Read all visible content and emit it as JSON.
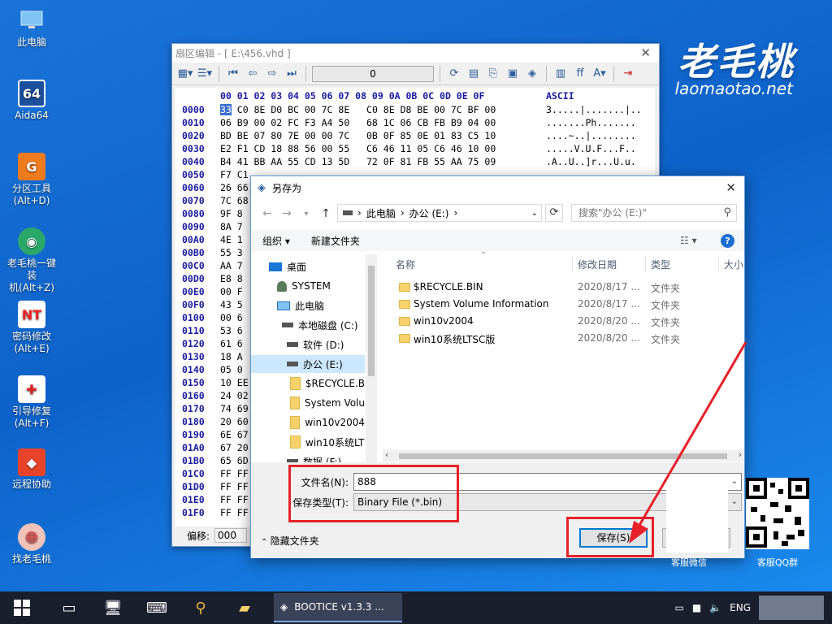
{
  "desktop": {
    "icons": [
      {
        "label": "此电脑",
        "icon": "computer-icon"
      },
      {
        "label": "Aida64",
        "icon": "aida64-icon"
      },
      {
        "label": "分区工具\n(Alt+D)",
        "icon": "partition-tool-icon"
      },
      {
        "label": "老毛桃一键装\n机(Alt+Z)",
        "icon": "installer-icon"
      },
      {
        "label": "密码修改\n(Alt+E)",
        "icon": "password-icon"
      },
      {
        "label": "引导修复\n(Alt+F)",
        "icon": "boot-repair-icon"
      },
      {
        "label": "远程协助",
        "icon": "remote-assist-icon"
      },
      {
        "label": "找老毛桃",
        "icon": "find-laomaotao-icon"
      }
    ],
    "watermark_logo": "老毛桃",
    "watermark_url": "laomaotao.net",
    "qr_left_caption": "客服微信",
    "qr_right_caption": "客服QQ群"
  },
  "hex_editor": {
    "title": "扇区编辑 - [ E:\\456.vhd ]",
    "sector_field": "0",
    "header_cols": "00 01 02 03 04 05 06 07   08 09 0A 0B 0C 0D 0E 0F",
    "ascii_header": "ASCII",
    "rows": [
      {
        "addr": "0000",
        "bytes": "33 C0 8E D0 BC 00 7C 8E   C0 8E D8 BE 00 7C BF 00",
        "ascii": "3.....|.......|.."
      },
      {
        "addr": "0010",
        "bytes": "06 B9 00 02 FC F3 A4 50   68 1C 06 CB FB B9 04 00",
        "ascii": ".......Ph......."
      },
      {
        "addr": "0020",
        "bytes": "BD BE 07 80 7E 00 00 7C   0B 0F 85 0E 01 83 C5 10",
        "ascii": "....~..|........"
      },
      {
        "addr": "0030",
        "bytes": "E2 F1 CD 18 88 56 00 55   C6 46 11 05 C6 46 10 00",
        "ascii": ".....V.U.F...F.."
      },
      {
        "addr": "0040",
        "bytes": "B4 41 BB AA 55 CD 13 5D   72 0F 81 FB 55 AA 75 09",
        "ascii": ".A..U..]r...U.u."
      },
      {
        "addr": "0050",
        "bytes": "F7 C1",
        "ascii": ""
      },
      {
        "addr": "0060",
        "bytes": "26 66",
        "ascii": ""
      },
      {
        "addr": "0070",
        "bytes": "7C 68",
        "ascii": ""
      },
      {
        "addr": "0080",
        "bytes": "9F 8",
        "ascii": ""
      },
      {
        "addr": "0090",
        "bytes": "8A 7",
        "ascii": ""
      },
      {
        "addr": "00A0",
        "bytes": "4E 1",
        "ascii": ""
      },
      {
        "addr": "00B0",
        "bytes": "55 3",
        "ascii": ""
      },
      {
        "addr": "00C0",
        "bytes": "AA 7",
        "ascii": ""
      },
      {
        "addr": "00D0",
        "bytes": "E8 8",
        "ascii": ""
      },
      {
        "addr": "00E0",
        "bytes": "00 F",
        "ascii": ""
      },
      {
        "addr": "00F0",
        "bytes": "43 5",
        "ascii": ""
      },
      {
        "addr": "0100",
        "bytes": "00 6",
        "ascii": ""
      },
      {
        "addr": "0110",
        "bytes": "53 6",
        "ascii": ""
      },
      {
        "addr": "0120",
        "bytes": "61 6",
        "ascii": ""
      },
      {
        "addr": "0130",
        "bytes": "18 A",
        "ascii": ""
      },
      {
        "addr": "0140",
        "bytes": "05 0",
        "ascii": ""
      },
      {
        "addr": "0150",
        "bytes": "10 EE",
        "ascii": ""
      },
      {
        "addr": "0160",
        "bytes": "24 02",
        "ascii": ""
      },
      {
        "addr": "0170",
        "bytes": "74 69",
        "ascii": ""
      },
      {
        "addr": "0180",
        "bytes": "20 60",
        "ascii": ""
      },
      {
        "addr": "0190",
        "bytes": "6E 67",
        "ascii": ""
      },
      {
        "addr": "01A0",
        "bytes": "67 20",
        "ascii": ""
      },
      {
        "addr": "01B0",
        "bytes": "65 6D",
        "ascii": ""
      },
      {
        "addr": "01C0",
        "bytes": "FF FF",
        "ascii": ""
      },
      {
        "addr": "01D0",
        "bytes": "FF FF",
        "ascii": ""
      },
      {
        "addr": "01E0",
        "bytes": "FF FF",
        "ascii": ""
      },
      {
        "addr": "01F0",
        "bytes": "FF FF",
        "ascii": ""
      }
    ],
    "status_offset_label": "偏移:",
    "status_offset_value": "000"
  },
  "dialog": {
    "title": "另存为",
    "breadcrumb": [
      "此电脑",
      "办公 (E:)"
    ],
    "search_placeholder": "搜索\"办公 (E:)\"",
    "organize_label": "组织 ▾",
    "new_folder_label": "新建文件夹",
    "nav_items": [
      {
        "label": "桌面",
        "icon": "desktop-icon"
      },
      {
        "label": "SYSTEM",
        "icon": "user-icon"
      },
      {
        "label": "此电脑",
        "icon": "computer-icon"
      },
      {
        "label": "本地磁盘 (C:)",
        "icon": "drive-icon"
      },
      {
        "label": "软件 (D:)",
        "icon": "drive-icon"
      },
      {
        "label": "办公 (E:)",
        "icon": "drive-icon"
      },
      {
        "label": "$RECYCLE.B",
        "icon": "folder-icon"
      },
      {
        "label": "System Volu",
        "icon": "folder-icon"
      },
      {
        "label": "win10v2004",
        "icon": "folder-icon"
      },
      {
        "label": "win10系统LT",
        "icon": "folder-icon"
      },
      {
        "label": "数据 (F:)",
        "icon": "drive-icon"
      }
    ],
    "columns": {
      "name": "名称",
      "date": "修改日期",
      "type": "类型",
      "size": "大小"
    },
    "files": [
      {
        "name": "$RECYCLE.BIN",
        "date": "2020/8/17 ...",
        "type": "文件夹"
      },
      {
        "name": "System Volume Information",
        "date": "2020/8/17 ...",
        "type": "文件夹"
      },
      {
        "name": "win10v2004",
        "date": "2020/8/20 ...",
        "type": "文件夹"
      },
      {
        "name": "win10系统LTSC版",
        "date": "2020/8/20 ...",
        "type": "文件夹"
      }
    ],
    "filename_label": "文件名(N):",
    "filename_value": "888",
    "filetype_label": "保存类型(T):",
    "filetype_value": "Binary File (*.bin)",
    "hide_folders_label": "隐藏文件夹",
    "save_button": "保存(S)",
    "cancel_button": "取消"
  },
  "taskbar": {
    "active_app": "BOOTICE v1.3.3 ...",
    "lang": "ENG"
  },
  "annotation_color": "#e8202a"
}
